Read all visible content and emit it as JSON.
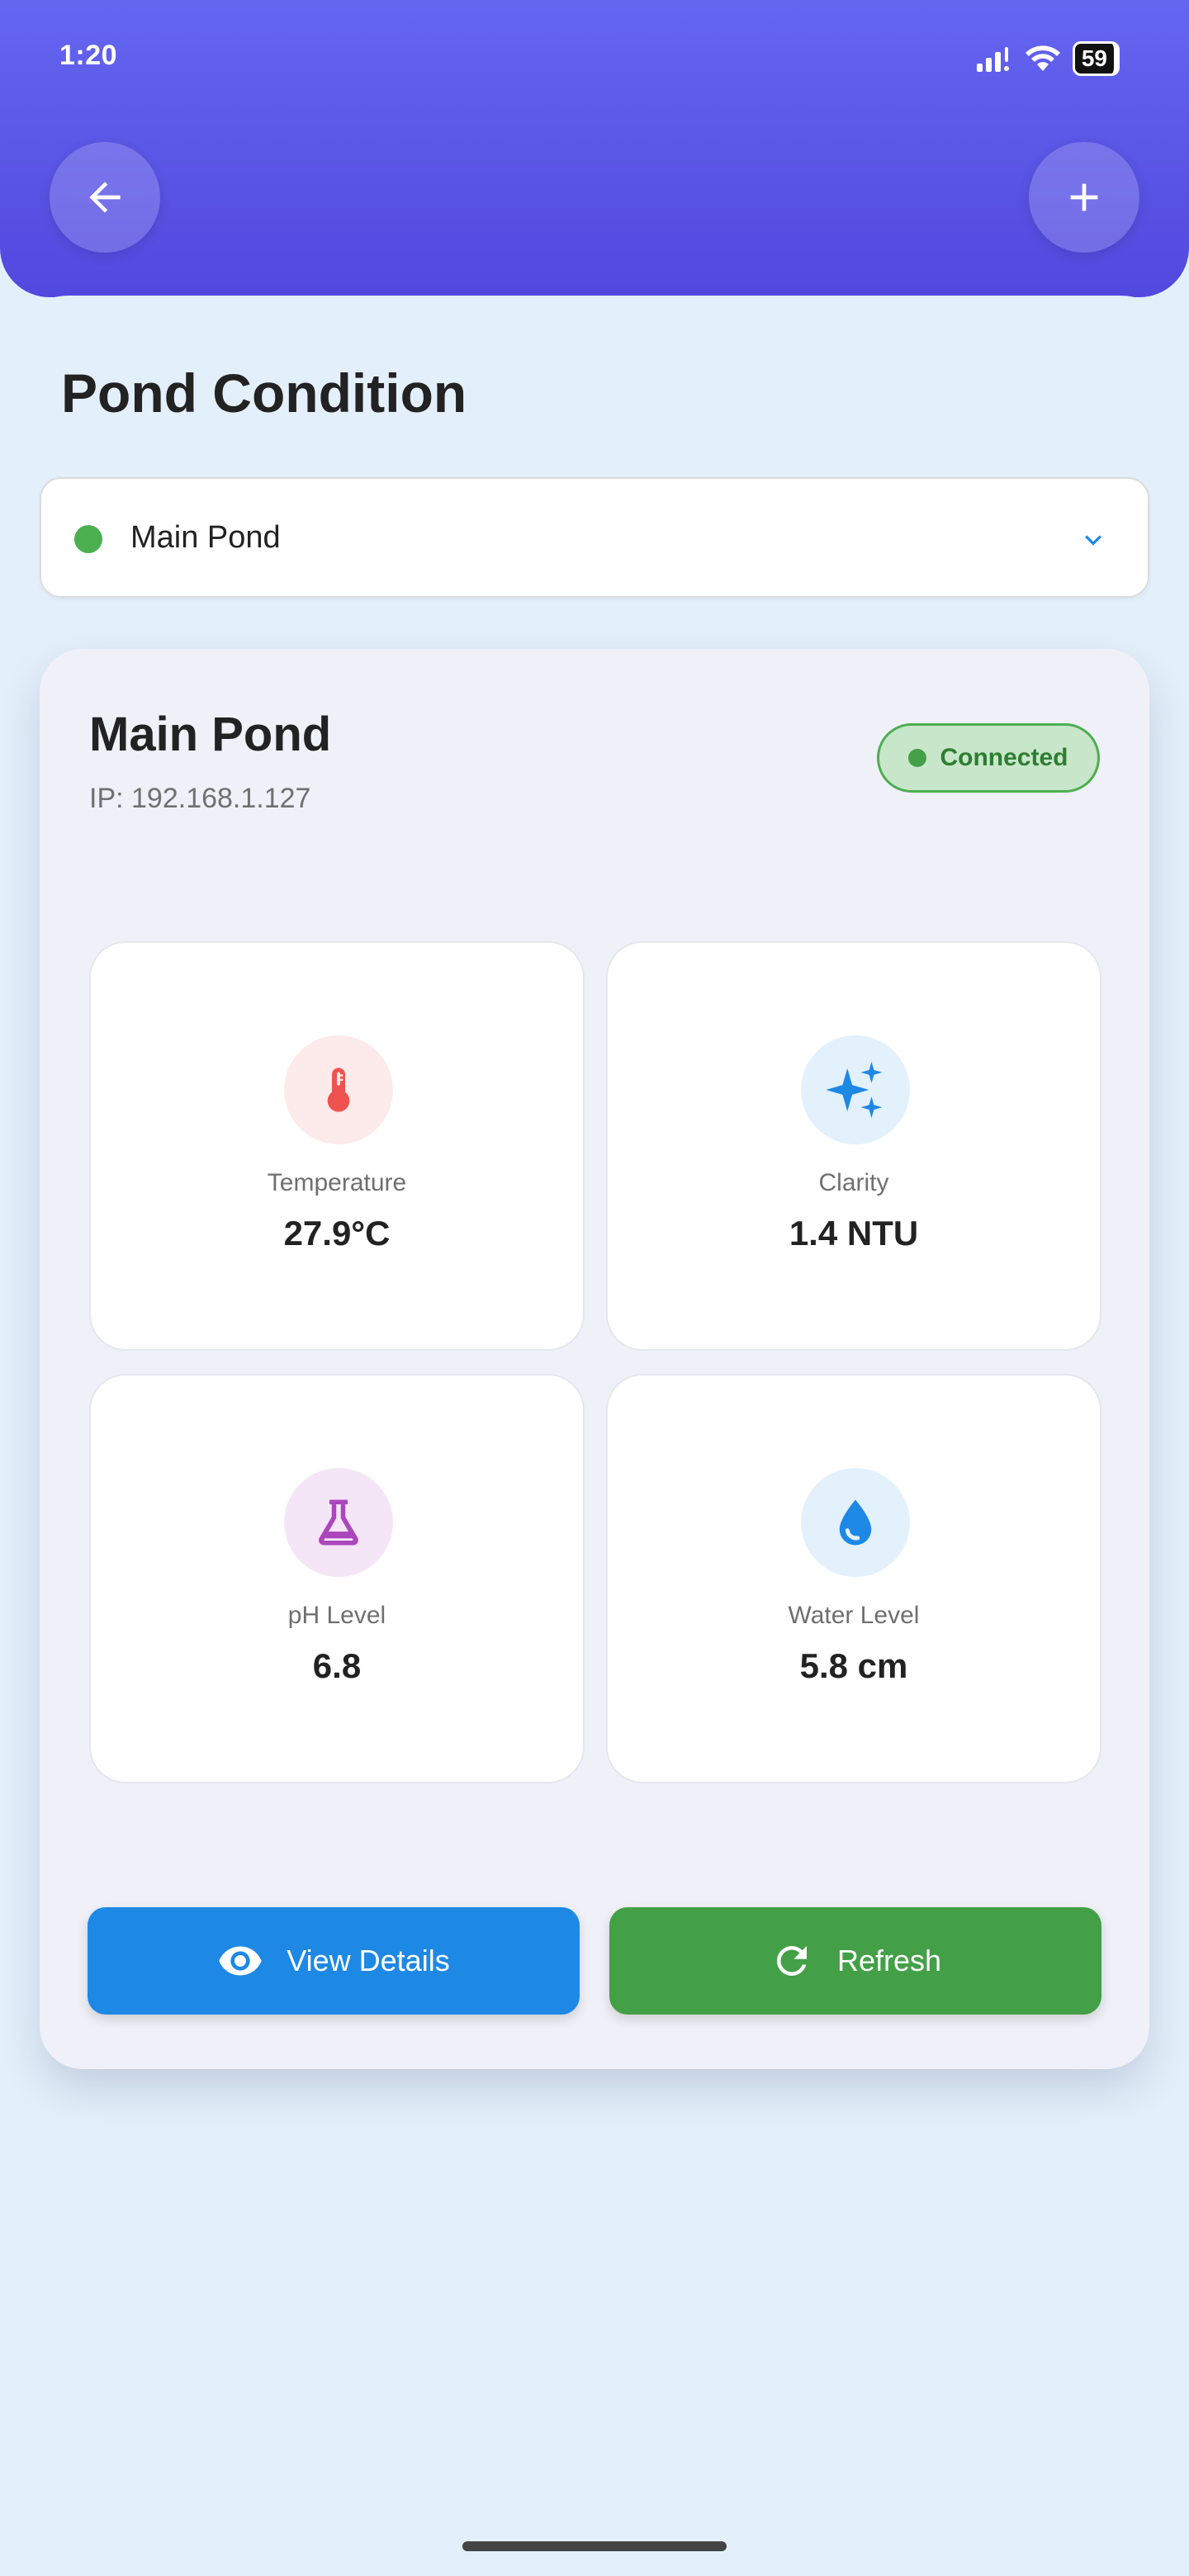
{
  "status_bar": {
    "time": "1:20",
    "battery": "59"
  },
  "header": {
    "back_icon": "arrow-left-icon",
    "add_icon": "plus-icon"
  },
  "page": {
    "title": "Pond Condition"
  },
  "pond_selector": {
    "selected": "Main Pond",
    "status_color": "#4caf50"
  },
  "pond_card": {
    "name": "Main Pond",
    "ip": "IP: 192.168.1.127",
    "status": "Connected",
    "metrics": [
      {
        "label": "Temperature",
        "value": "27.9°C",
        "icon": "thermometer-icon",
        "color": "#ef5350"
      },
      {
        "label": "Clarity",
        "value": "1.4 NTU",
        "icon": "sparkle-icon",
        "color": "#1e88e5"
      },
      {
        "label": "pH Level",
        "value": "6.8",
        "icon": "flask-icon",
        "color": "#ab47bc"
      },
      {
        "label": "Water Level",
        "value": "5.8 cm",
        "icon": "water-drop-icon",
        "color": "#1e88e5"
      }
    ],
    "actions": {
      "view_details": "View Details",
      "refresh": "Refresh"
    }
  },
  "colors": {
    "header": "#5b58e8",
    "view_button": "#1e88e5",
    "refresh_button": "#43a047",
    "background": "#e3f0fb"
  }
}
